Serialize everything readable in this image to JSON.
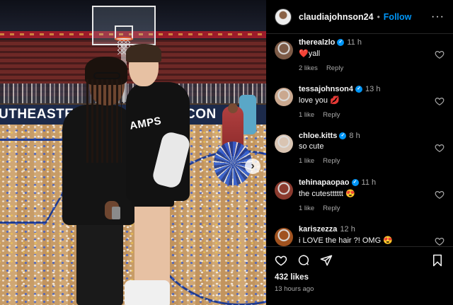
{
  "header": {
    "username": "claudiajohnson24",
    "separator": "•",
    "follow_label": "Follow",
    "more_label": "···"
  },
  "photo": {
    "banner_left": "UTHEASTERN",
    "banner_right": "CON",
    "shirt_text": "AMPS",
    "next_label": "›"
  },
  "comments": [
    {
      "username": "therealzlo",
      "verified": true,
      "time": "11 h",
      "text": "❤️yall",
      "likes": "2 likes",
      "reply": "Reply",
      "avatar_color": "#7d5b47"
    },
    {
      "username": "tessajohnson4",
      "verified": true,
      "time": "13 h",
      "text": "love you 💋",
      "likes": "1 like",
      "reply": "Reply",
      "avatar_color": "#caa88f"
    },
    {
      "username": "chloe.kitts",
      "verified": true,
      "time": "8 h",
      "text": "so cute",
      "likes": "1 like",
      "reply": "Reply",
      "avatar_color": "#d9c4b2"
    },
    {
      "username": "tehinapaopao",
      "verified": true,
      "time": "11 h",
      "text": "the cutestttttt 😍",
      "likes": "1 like",
      "reply": "Reply",
      "avatar_color": "#8b3a2e"
    },
    {
      "username": "kariszezza",
      "verified": false,
      "time": "12 h",
      "text": "i LOVE the hair ?! OMG 😍",
      "likes": "",
      "reply": "",
      "avatar_color": "#a0521f"
    }
  ],
  "actions": {
    "likes_count": "432 likes",
    "posted_ago": "13 hours ago"
  },
  "colors": {
    "background": "#000000",
    "follow_blue": "#0095f6",
    "verified_blue": "#0095f6",
    "muted_text": "#a8a8a8",
    "divider": "#262626"
  },
  "icons": [
    "verified-badge-icon",
    "heart-icon",
    "comment-icon",
    "share-icon",
    "bookmark-icon",
    "more-icon",
    "next-arrow-icon"
  ]
}
